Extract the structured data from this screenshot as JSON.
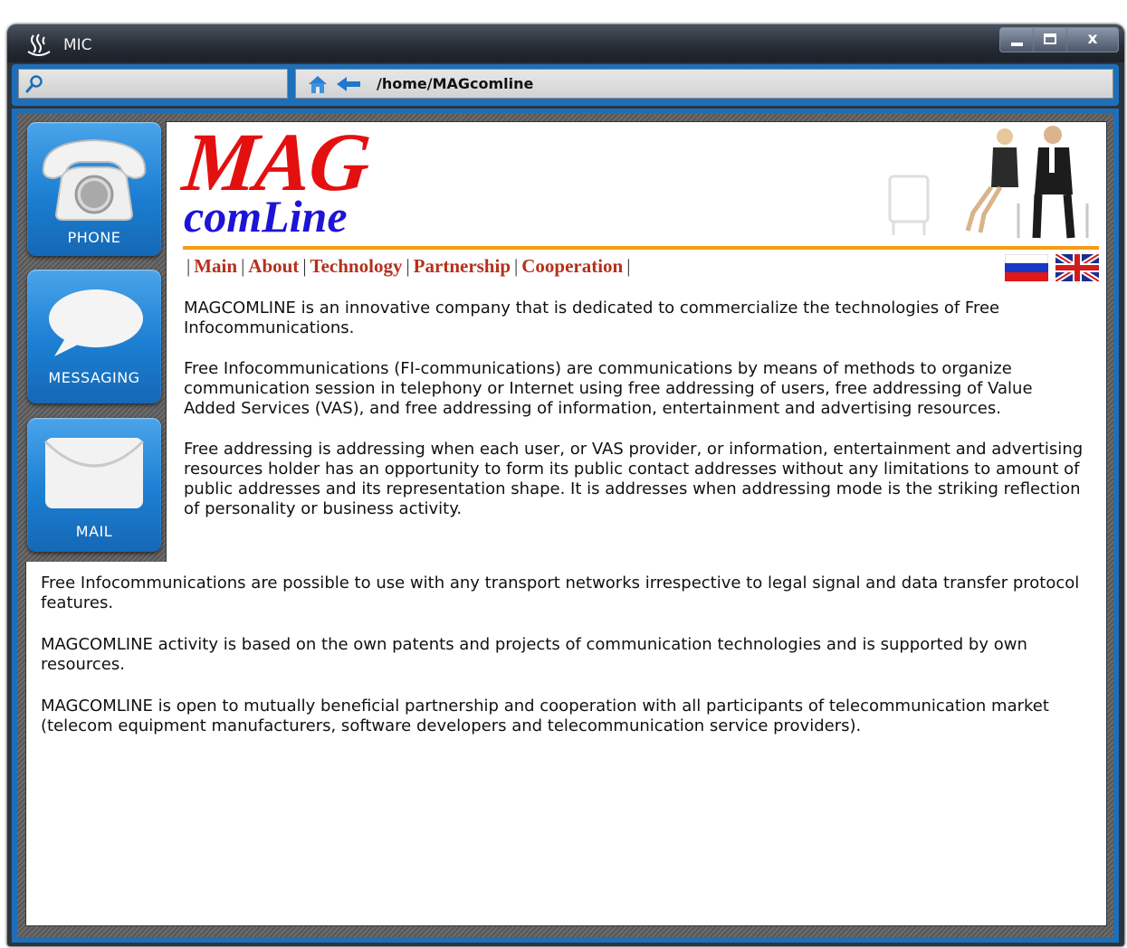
{
  "window": {
    "title": "MIC",
    "minimize_label": "",
    "maximize_label": "",
    "close_label": "x"
  },
  "toolbar": {
    "search_placeholder": "",
    "address": "/home/MAGcomline"
  },
  "side_buttons": [
    {
      "label": "PHONE"
    },
    {
      "label": "MESSAGING"
    },
    {
      "label": "MAIL"
    }
  ],
  "site": {
    "logo_line1": "MAG",
    "logo_line2": "comLine",
    "nav": [
      "Main",
      "About",
      "Technology",
      "Partnership",
      "Cooperation"
    ],
    "nav_separator": "|",
    "paragraphs_top": [
      "MAGCOMLINE is an innovative company that is dedicated to commercialize the technologies of Free Infocommunications.",
      "Free Infocommunications (FI-communications) are communications by means of methods to organize communication session in telephony or Internet using free addressing of users, free addressing of Value Added Services (VAS), and free addressing of information, entertainment and advertising resources.",
      "Free addressing is addressing when each user, or VAS provider, or information, entertainment and advertising resources holder has an opportunity to form its public contact addresses without any limitations to amount of public addresses and its representation shape. It is addresses when addressing mode is the striking reflection of personality or business activity."
    ],
    "paragraphs_bottom": [
      "Free Infocommunications are possible to use with any transport networks irrespective to legal signal and data transfer protocol features.",
      "MAGCOMLINE activity is based on the own patents and projects of communication technologies and is supported by own resources.",
      "MAGCOMLINE is open to mutually beneficial partnership and cooperation with all participants of telecommunication market (telecom equipment manufacturers, software developers and telecommunication service providers)."
    ]
  },
  "colors": {
    "frame_blue": "#1f6fb8",
    "logo_red": "#e41010",
    "logo_blue": "#1d14d6",
    "nav_link": "#b5301c",
    "rule_orange": "#f39b16"
  }
}
